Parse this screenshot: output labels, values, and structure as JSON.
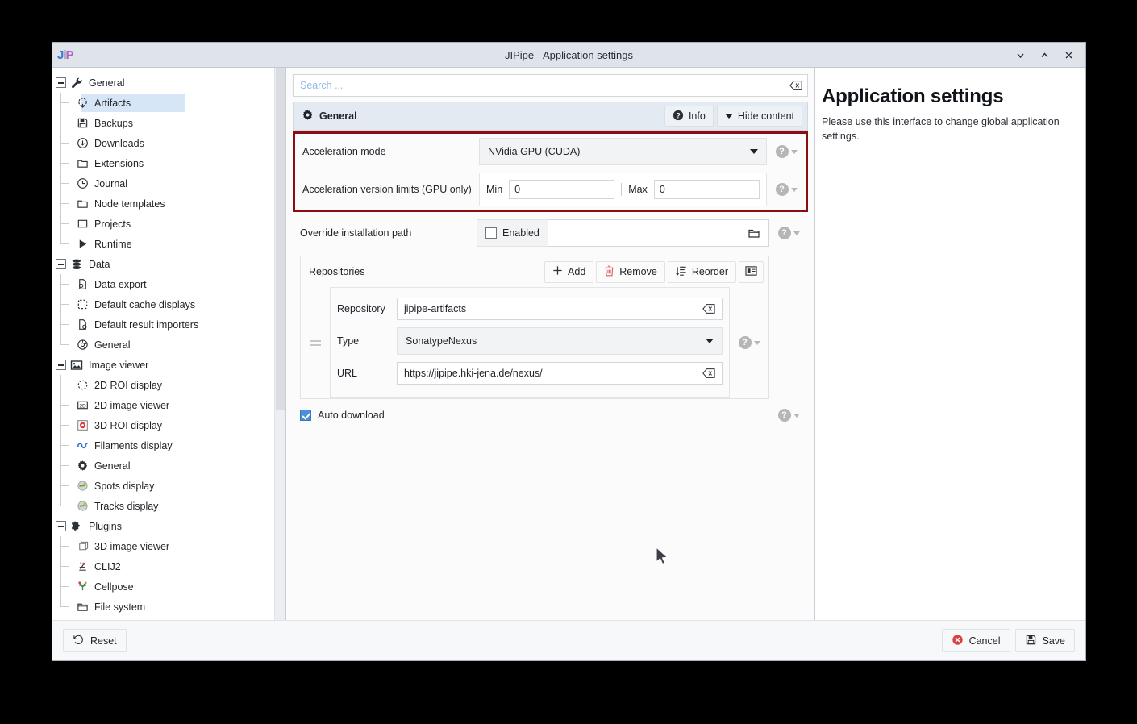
{
  "window": {
    "title": "JIPipe - Application settings",
    "logo_text": "JiP",
    "controls": [
      {
        "name": "minimize",
        "glyph": "chevron-down"
      },
      {
        "name": "maximize",
        "glyph": "chevron-up"
      },
      {
        "name": "close",
        "glyph": "cross"
      }
    ]
  },
  "search": {
    "placeholder": "Search ...",
    "value": "",
    "clear_icon": "clear-text-icon"
  },
  "sidebar": {
    "groups": [
      {
        "label": "General",
        "icon": "wrench-icon",
        "items": [
          {
            "label": "Artifacts",
            "icon": "artifacts-icon",
            "selected": true
          },
          {
            "label": "Backups",
            "icon": "floppy-disk-icon",
            "selected": false
          },
          {
            "label": "Downloads",
            "icon": "download-circle-icon",
            "selected": false
          },
          {
            "label": "Extensions",
            "icon": "folder-icon",
            "selected": false
          },
          {
            "label": "Journal",
            "icon": "clock-icon",
            "selected": false
          },
          {
            "label": "Node templates",
            "icon": "folder-icon",
            "selected": false
          },
          {
            "label": "Projects",
            "icon": "square-icon",
            "selected": false
          },
          {
            "label": "Runtime",
            "icon": "play-triangle-icon",
            "selected": false
          }
        ]
      },
      {
        "label": "Data",
        "icon": "database-icon",
        "items": [
          {
            "label": "Data export",
            "icon": "file-export-icon",
            "selected": false
          },
          {
            "label": "Default cache displays",
            "icon": "dashed-square-icon",
            "selected": false
          },
          {
            "label": "Default result importers",
            "icon": "file-import-icon",
            "selected": false
          },
          {
            "label": "General",
            "icon": "gear-outline-icon",
            "selected": false
          }
        ]
      },
      {
        "label": "Image viewer",
        "icon": "picture-icon",
        "items": [
          {
            "label": "2D ROI display",
            "icon": "dashed-circle-icon",
            "selected": false
          },
          {
            "label": "2D image viewer",
            "icon": "2d-badge-icon",
            "selected": false
          },
          {
            "label": "3D ROI display",
            "icon": "3d-roi-icon",
            "selected": false
          },
          {
            "label": "Filaments display",
            "icon": "filaments-icon",
            "selected": false
          },
          {
            "label": "General",
            "icon": "gear-icon",
            "selected": false
          },
          {
            "label": "Spots display",
            "icon": "spots-icon",
            "selected": false
          },
          {
            "label": "Tracks display",
            "icon": "tracks-icon",
            "selected": false
          }
        ]
      },
      {
        "label": "Plugins",
        "icon": "puzzle-icon",
        "items": [
          {
            "label": "3D image viewer",
            "icon": "cube-icon",
            "selected": false
          },
          {
            "label": "CLIJ2",
            "icon": "clij2-icon",
            "selected": false
          },
          {
            "label": "Cellpose",
            "icon": "cellpose-icon",
            "selected": false
          },
          {
            "label": "File system",
            "icon": "folder-open-icon",
            "selected": false
          }
        ]
      }
    ]
  },
  "panel": {
    "title": "General",
    "title_icon": "gear-icon",
    "info_label": "Info",
    "info_icon": "info-circle-icon",
    "hide_label": "Hide content",
    "hide_icon": "caret-down-icon"
  },
  "form": {
    "acceleration_mode": {
      "label": "Acceleration mode",
      "value": "NVidia GPU (CUDA)"
    },
    "acceleration_limits": {
      "label": "Acceleration version limits (GPU only)",
      "min_label": "Min",
      "min_value": "0",
      "max_label": "Max",
      "max_value": "0"
    },
    "override_path": {
      "label": "Override installation path",
      "checkbox_label": "Enabled",
      "checked": false,
      "value": "",
      "browse_icon": "folder-browse-icon"
    },
    "repositories": {
      "title": "Repositories",
      "buttons": [
        {
          "label": "Add",
          "icon": "plus-icon"
        },
        {
          "label": "Remove",
          "icon": "trash-icon"
        },
        {
          "label": "Reorder",
          "icon": "reorder-icon"
        },
        {
          "label": "",
          "icon": "list-view-icon"
        }
      ],
      "entry": {
        "repository_label": "Repository",
        "repository_value": "jipipe-artifacts",
        "type_label": "Type",
        "type_value": "SonatypeNexus",
        "url_label": "URL",
        "url_value": "https://jipipe.hki-jena.de/nexus/"
      }
    },
    "auto_download": {
      "label": "Auto download",
      "checked": true
    },
    "help_icon": "help-circle-icon"
  },
  "info_panel": {
    "heading": "Application settings",
    "text": "Please use this interface to change global application settings."
  },
  "footer": {
    "reset_label": "Reset",
    "reset_icon": "undo-icon",
    "cancel_label": "Cancel",
    "cancel_icon": "cancel-circle-icon",
    "save_label": "Save",
    "save_icon": "floppy-disk-icon"
  },
  "colors": {
    "highlight_border": "#8b0d12",
    "selection": "#d6e6f7",
    "titlebar": "#dfe3ea",
    "panel_header": "#e4eaf2",
    "accent_checkbox": "#4a90d9",
    "remove_red": "#e05a5a"
  }
}
